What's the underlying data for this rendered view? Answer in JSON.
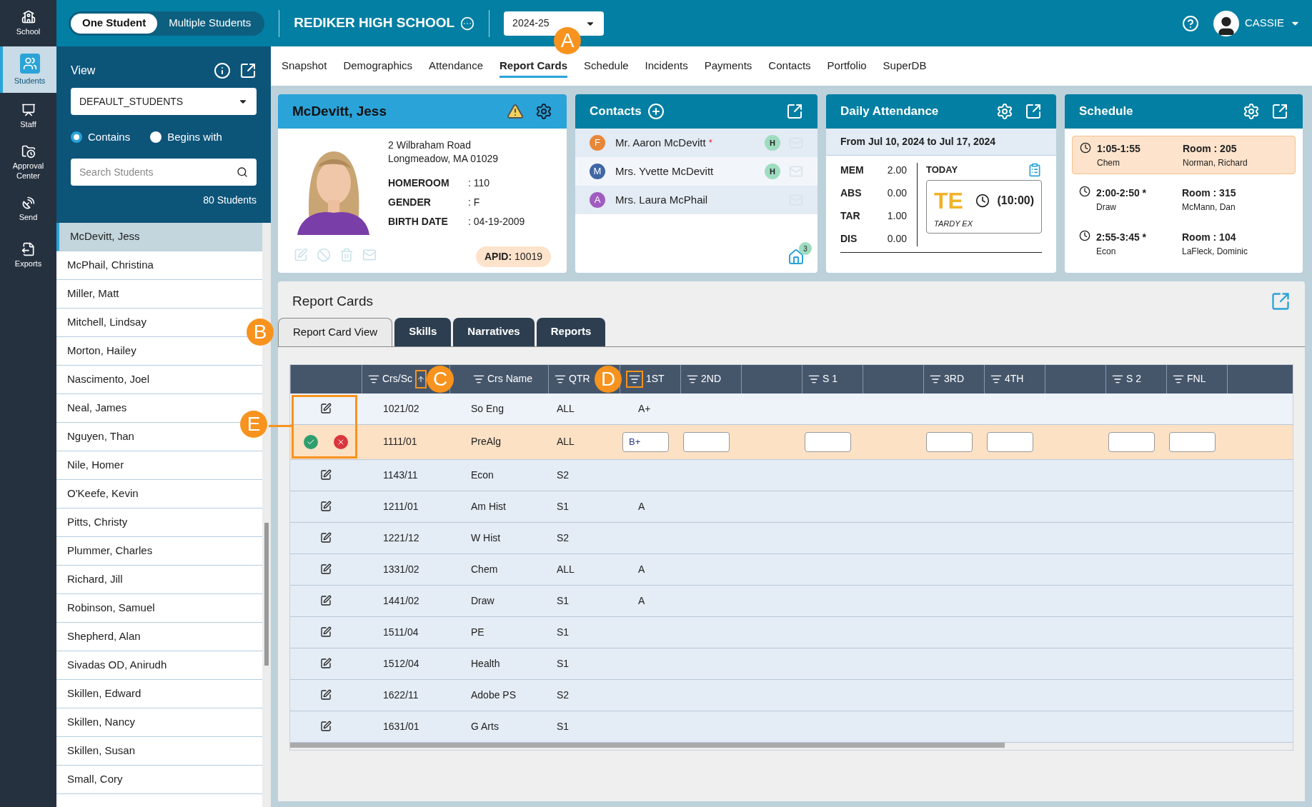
{
  "rail": [
    {
      "label": "School",
      "selected": false
    },
    {
      "label": "Students",
      "selected": true
    },
    {
      "label": "Staff",
      "selected": false
    },
    {
      "label": "Approval Center",
      "selected": false
    },
    {
      "label": "Send",
      "selected": false
    },
    {
      "label": "Exports",
      "selected": false
    }
  ],
  "mode_toggle": [
    {
      "label": "One Student",
      "selected": true
    },
    {
      "label": "Multiple Students",
      "selected": false
    }
  ],
  "school_name": "REDIKER HIGH SCHOOL",
  "year_select": "2024-25",
  "user": "CASSIE",
  "callouts": [
    "A",
    "B",
    "C",
    "D",
    "E"
  ],
  "sidebar": {
    "view_label": "View",
    "view_select": "DEFAULT_STUDENTS",
    "match_options": [
      {
        "label": "Contains",
        "selected": true
      },
      {
        "label": "Begins with",
        "selected": false
      }
    ],
    "search": {
      "placeholder": "Search Students"
    },
    "count": "80 Students",
    "students": [
      {
        "name": "McDevitt, Jess",
        "selected": true
      },
      {
        "name": "McPhail, Christina",
        "selected": false
      },
      {
        "name": "Miller, Matt",
        "selected": false
      },
      {
        "name": "Mitchell, Lindsay",
        "selected": false
      },
      {
        "name": "Morton, Hailey",
        "selected": false
      },
      {
        "name": "Nascimento, Joel",
        "selected": false
      },
      {
        "name": "Neal, James",
        "selected": false
      },
      {
        "name": "Nguyen, Than",
        "selected": false
      },
      {
        "name": "Nile, Homer",
        "selected": false
      },
      {
        "name": "O'Keefe, Kevin",
        "selected": false
      },
      {
        "name": "Pitts, Christy",
        "selected": false
      },
      {
        "name": "Plummer, Charles",
        "selected": false
      },
      {
        "name": "Richard, Jill",
        "selected": false
      },
      {
        "name": "Robinson, Samuel",
        "selected": false
      },
      {
        "name": "Shepherd, Alan",
        "selected": false
      },
      {
        "name": "Sivadas OD, Anirudh",
        "selected": false
      },
      {
        "name": "Skillen, Edward",
        "selected": false
      },
      {
        "name": "Skillen, Nancy",
        "selected": false
      },
      {
        "name": "Skillen, Susan",
        "selected": false
      },
      {
        "name": "Small, Cory",
        "selected": false
      }
    ]
  },
  "nav_tabs": [
    {
      "label": "Snapshot",
      "selected": false
    },
    {
      "label": "Demographics",
      "selected": false
    },
    {
      "label": "Attendance",
      "selected": false
    },
    {
      "label": "Report Cards",
      "selected": true
    },
    {
      "label": "Schedule",
      "selected": false
    },
    {
      "label": "Incidents",
      "selected": false
    },
    {
      "label": "Payments",
      "selected": false
    },
    {
      "label": "Contacts",
      "selected": false
    },
    {
      "label": "Portfolio",
      "selected": false
    },
    {
      "label": "SuperDB",
      "selected": false
    }
  ],
  "student": {
    "name": "McDevitt, Jess",
    "address": [
      "2 Wilbraham Road",
      "Longmeadow, MA 01029"
    ],
    "fields": [
      {
        "label": "HOMEROOM",
        "value": ": 110"
      },
      {
        "label": "GENDER",
        "value": ": F"
      },
      {
        "label": "BIRTH DATE",
        "value": ": 04-19-2009"
      }
    ],
    "apid_label": "APID:",
    "apid": "10019"
  },
  "contacts": {
    "title": "Contacts",
    "household_count": "3",
    "items": [
      {
        "initial": "F",
        "color": "#e8873a",
        "name": "Mr. Aaron McDevitt",
        "required_mark": "*",
        "home_badge": "H"
      },
      {
        "initial": "M",
        "color": "#3f67a6",
        "name": "Mrs. Yvette McDevitt",
        "home_badge": "H"
      },
      {
        "initial": "A",
        "color": "#a05cbf",
        "name": "Mrs. Laura McPhail"
      }
    ]
  },
  "attendance": {
    "title": "Daily Attendance",
    "range": "From Jul 10, 2024 to Jul 17, 2024",
    "stats": [
      {
        "label": "MEM",
        "value": "2.00"
      },
      {
        "label": "ABS",
        "value": "0.00"
      },
      {
        "label": "TAR",
        "value": "1.00"
      },
      {
        "label": "DIS",
        "value": "0.00"
      }
    ],
    "today_label": "TODAY",
    "code": "TE",
    "time": "(10:00)",
    "note": "TARDY EX"
  },
  "schedule": {
    "title": "Schedule",
    "items": [
      {
        "time": "1:05-1:55",
        "course": "Chem",
        "room": "Room : 205",
        "teacher": "Norman, Richard",
        "selected": true
      },
      {
        "time": "2:00-2:50 *",
        "course": "Draw",
        "room": "Room : 315",
        "teacher": "McMann, Dan",
        "selected": false
      },
      {
        "time": "2:55-3:45 *",
        "course": "Econ",
        "room": "Room : 104",
        "teacher": "LaFleck, Dominic",
        "selected": false
      }
    ]
  },
  "report_cards": {
    "title": "Report Cards",
    "tabs": [
      {
        "label": "Report Card View",
        "selected": true
      },
      {
        "label": "Skills",
        "selected": false
      },
      {
        "label": "Narratives",
        "selected": false
      },
      {
        "label": "Reports",
        "selected": false
      }
    ],
    "columns": [
      {
        "kind": "blank"
      },
      {
        "kind": "sorted",
        "label": "Crs/Sc"
      },
      {
        "kind": "filter",
        "label": "Crs Name"
      },
      {
        "kind": "filter",
        "label": "QTR"
      },
      {
        "kind": "filter",
        "label": "1ST"
      },
      {
        "kind": "filter",
        "label": "2ND"
      },
      {
        "kind": "blank"
      },
      {
        "kind": "filter",
        "label": "S 1"
      },
      {
        "kind": "blank"
      },
      {
        "kind": "filter",
        "label": "3RD"
      },
      {
        "kind": "filter",
        "label": "4TH"
      },
      {
        "kind": "blank"
      },
      {
        "kind": "filter",
        "label": "S 2"
      },
      {
        "kind": "filter",
        "label": "FNL"
      },
      {
        "kind": "blank"
      }
    ],
    "rows": [
      {
        "section": "1021/02",
        "course": "So Eng",
        "term": "ALL",
        "grade_1st": "A+",
        "editing": false
      },
      {
        "section": "1111/01",
        "course": "PreAlg",
        "term": "ALL",
        "grade_1st": "B+",
        "editing": true
      },
      {
        "section": "1143/11",
        "course": "Econ",
        "term": "S2",
        "editing": false
      },
      {
        "section": "1211/01",
        "course": "Am Hist",
        "term": "S1",
        "grade_1st": "A",
        "editing": false
      },
      {
        "section": "1221/12",
        "course": "W Hist",
        "term": "S2",
        "editing": false
      },
      {
        "section": "1331/02",
        "course": "Chem",
        "term": "ALL",
        "grade_1st": "A",
        "editing": false
      },
      {
        "section": "1441/02",
        "course": "Draw",
        "term": "S1",
        "grade_1st": "A",
        "editing": false
      },
      {
        "section": "1511/04",
        "course": "PE",
        "term": "S1",
        "editing": false
      },
      {
        "section": "1512/04",
        "course": "Health",
        "term": "S1",
        "editing": false
      },
      {
        "section": "1622/11",
        "course": "Adobe PS",
        "term": "S2",
        "editing": false
      },
      {
        "section": "1631/01",
        "course": "G Arts",
        "term": "S1",
        "editing": false
      }
    ]
  }
}
